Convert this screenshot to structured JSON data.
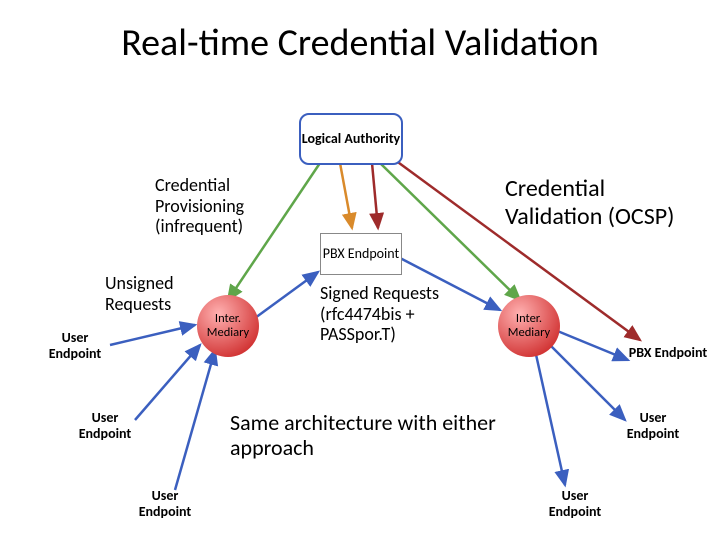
{
  "title": "Real-time Credential Validation",
  "logical_authority": "Logical Authority",
  "cred_prov": "Credential Provisioning (infrequent)",
  "cred_val": "Credential Validation (OCSP)",
  "pbx": "PBX Endpoint",
  "unsigned": "Unsigned Requests",
  "signed": "Signed Requests (rfc4474bis + PASSpor.T)",
  "intermediary": "Inter. Mediary",
  "user_ep": "User Endpoint",
  "same_arch": "Same architecture with either approach",
  "colors": {
    "green": "#5fa64a",
    "orange": "#d98a2b",
    "red": "#9e2b2b",
    "blue": "#3b5fbf"
  }
}
